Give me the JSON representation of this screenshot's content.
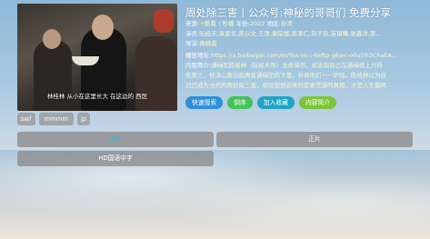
{
  "detail": {
    "title": "周处除三害丨公众号:神秘的哥哥们 免费分享",
    "source_label": "来源:",
    "source_value": "酷看丨秒播",
    "year_label": "年份:",
    "year_value": "2022",
    "region_label": "地区:",
    "region_value": "台湾",
    "actors_label": "演员:",
    "actors_value": "阮经天,袁富华,陈以文,王净,谢琼煖,李李仁,刘子铨,苗镇曦,张鑫洋,李...",
    "director_label": "导演:",
    "director_value": "黄精甫",
    "play_addr_label": "播放地址:",
    "play_addr_value": "https://a.baibaipei.com/m/fea-on-i-6eftp-g6wc-o0uDh3ChaEA...",
    "intro_label": "内容简介:",
    "intro_line1": "通缉犯陈桂林（阮经天饰）生命将尽，却发现自己在通缉榜上只排",
    "intro_line2": "名第三，他决心查出前两名通缉犯的下落，并将他们一一铲除。陈桂林以为自",
    "intro_line3": "己已成为当代的周处除三害，却没想到迎来的是更荒谬的真相，才是人生最终..."
  },
  "poster": {
    "subtitle": "林桂林 从小在这里长大 在这边的 西医"
  },
  "actions": {
    "search": "快速搜索",
    "danmaku": "倒序",
    "favorite": "加入收藏",
    "intro": "内容简介"
  },
  "sources": {
    "chips": [
      "swf",
      "mmmm",
      "jp"
    ]
  },
  "play_groups": {
    "left_tab": "正片",
    "right_tab": "正片"
  },
  "episodes": [
    "HD国语中字"
  ],
  "colors": {
    "accent_blue": "#2f8fd8",
    "accent_green": "#46c25a",
    "selected_text": "#1ec2d6"
  }
}
